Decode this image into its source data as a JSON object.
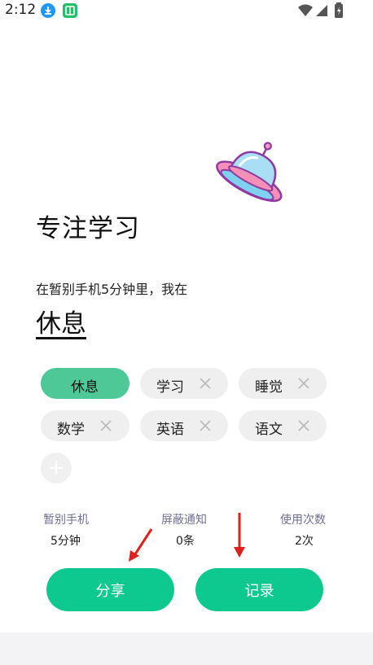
{
  "status_bar": {
    "time": "2:12"
  },
  "focus": {
    "title": "专注学习",
    "subtitle": "在暂别手机5分钟里，我在",
    "current_activity": "休息"
  },
  "tags": [
    {
      "label": "休息",
      "selected": true
    },
    {
      "label": "学习",
      "selected": false
    },
    {
      "label": "睡觉",
      "selected": false
    },
    {
      "label": "数学",
      "selected": false
    },
    {
      "label": "英语",
      "selected": false
    },
    {
      "label": "语文",
      "selected": false
    }
  ],
  "stats": [
    {
      "label": "暂别手机",
      "value": "5分钟"
    },
    {
      "label": "屏蔽通知",
      "value": "0条"
    },
    {
      "label": "使用次数",
      "value": "2次"
    }
  ],
  "buttons": {
    "share": "分享",
    "record": "记录"
  },
  "colors": {
    "accent": "#0ec98f",
    "selected_tag": "#4ec897",
    "annotation_arrow": "#e0201a"
  }
}
